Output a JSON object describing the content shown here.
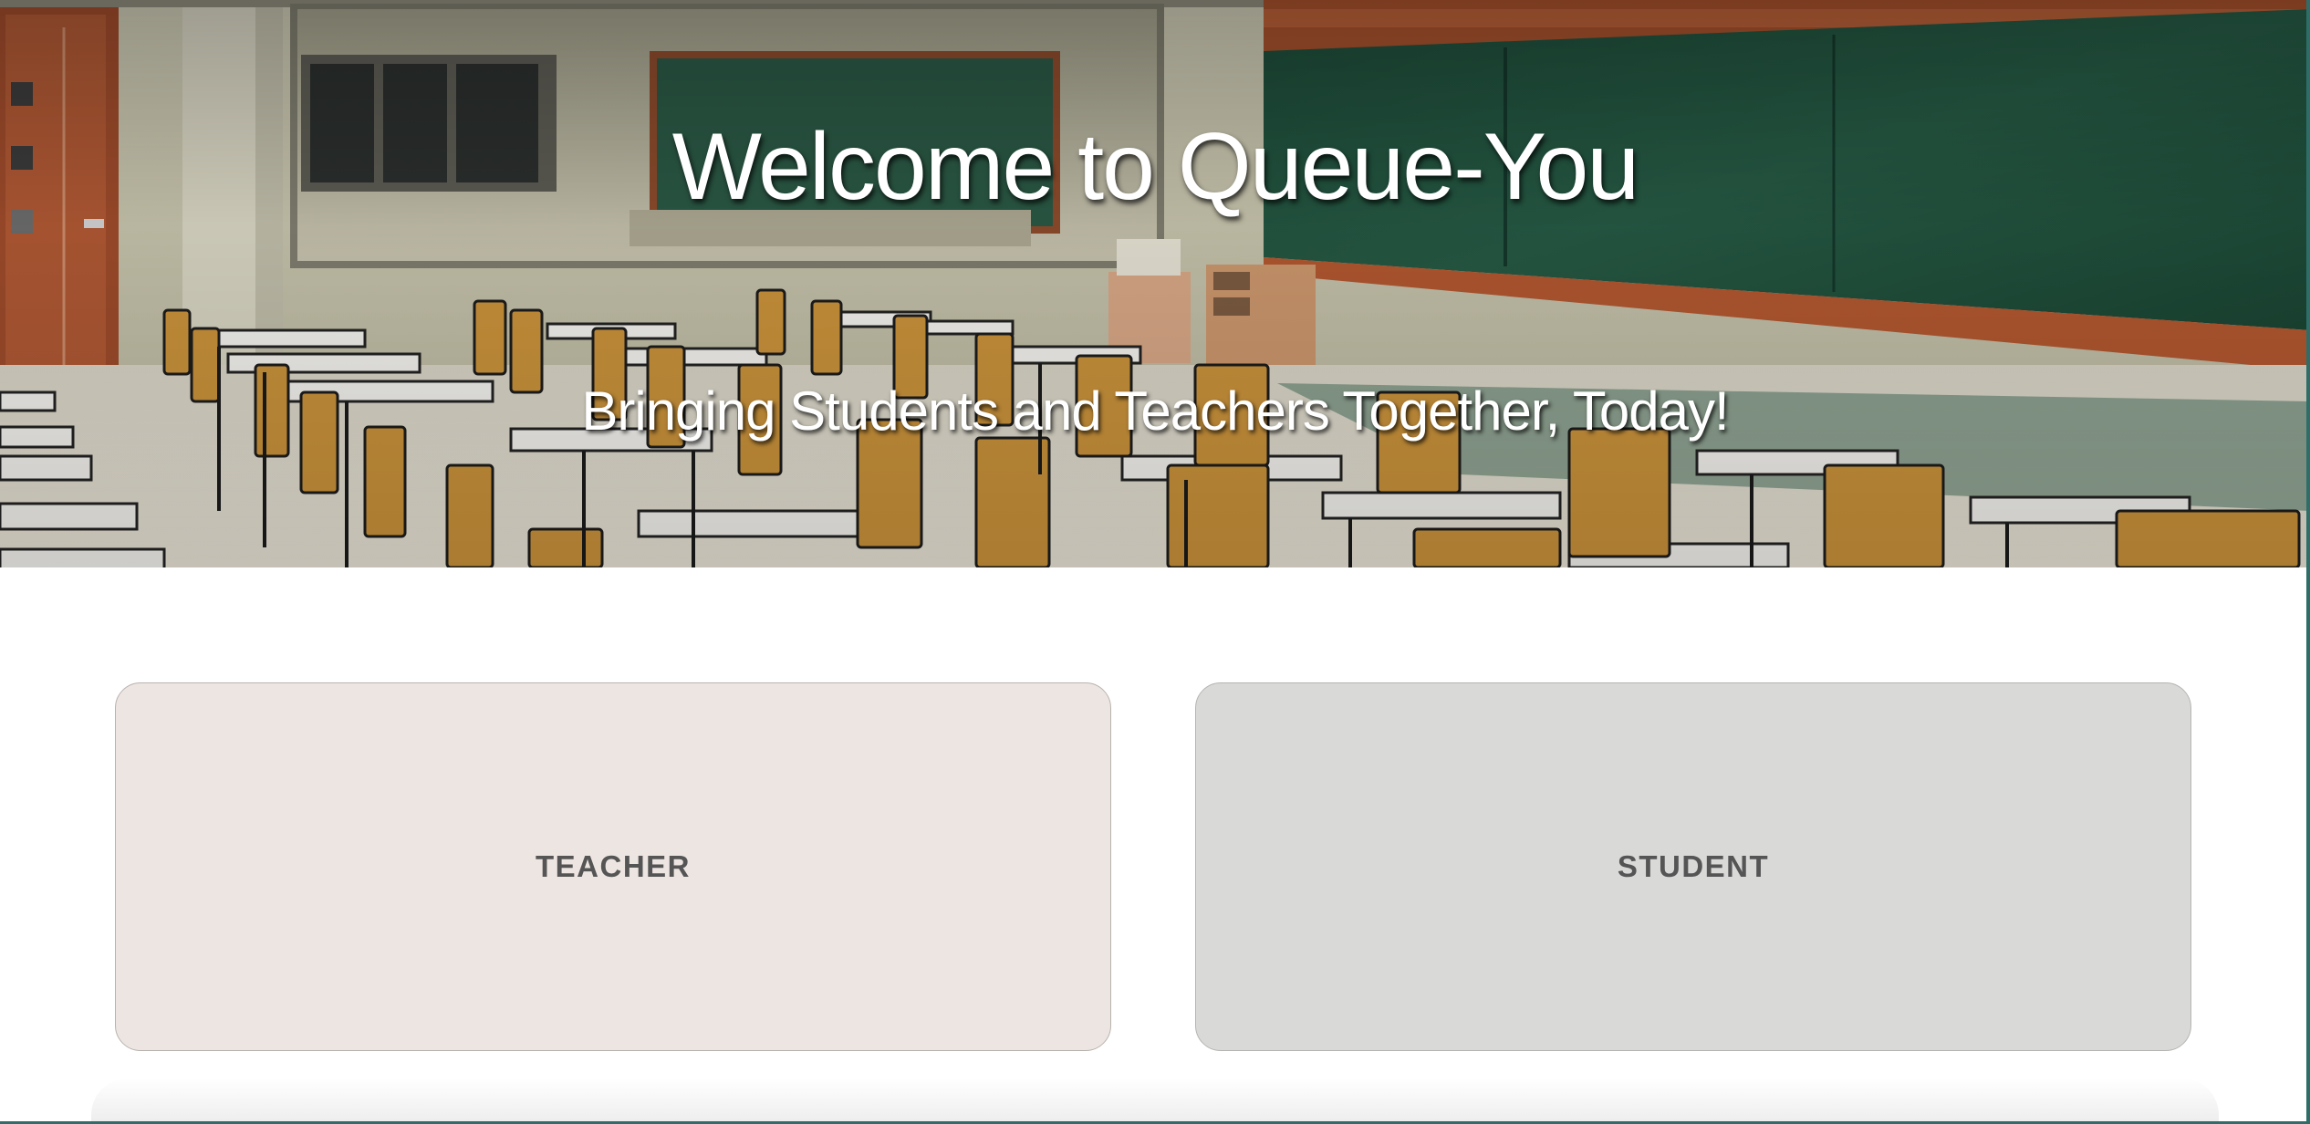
{
  "hero": {
    "title": "Welcome to Queue-You",
    "subtitle": "Bringing Students and Teachers Together, Today!",
    "background_icon": "classroom-photo"
  },
  "roles": {
    "teacher_label": "TEACHER",
    "student_label": "STUDENT"
  },
  "colors": {
    "teacher_card": "#ede5e1",
    "student_card": "#d9d9d8",
    "label_text": "#555555",
    "chalkboard": "#1f4a39",
    "board_frame": "#a5522d"
  }
}
